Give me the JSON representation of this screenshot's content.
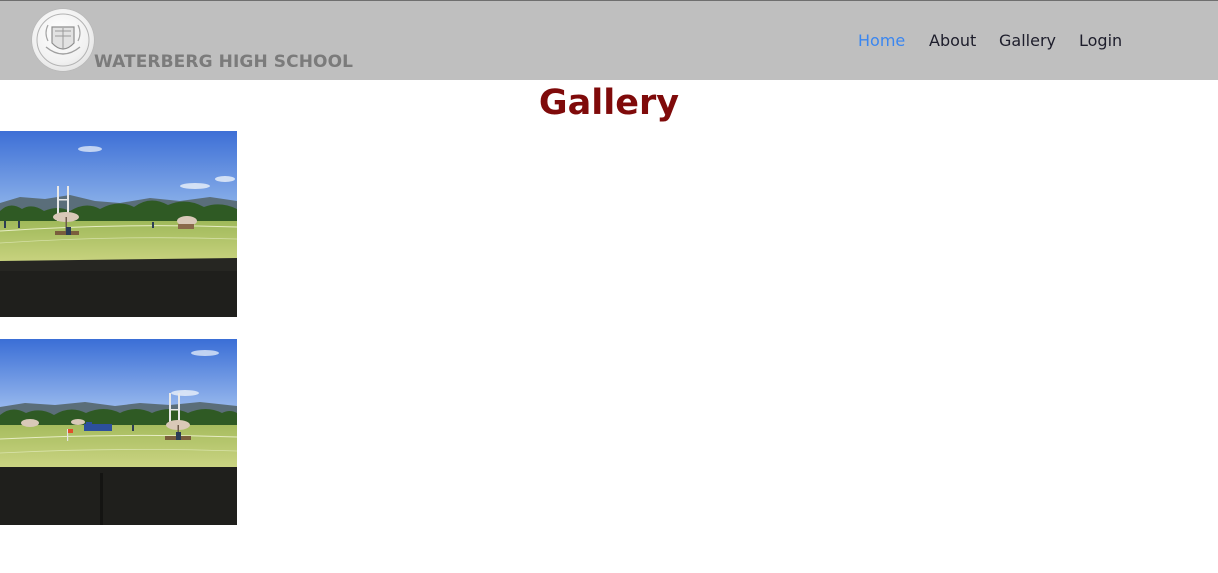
{
  "header": {
    "school_name": "WATERBERG HIGH SCHOOL",
    "logo_icon": "school-crest-icon"
  },
  "nav": {
    "items": [
      {
        "label": "Home",
        "active": true
      },
      {
        "label": "About",
        "active": false
      },
      {
        "label": "Gallery",
        "active": false
      },
      {
        "label": "Login",
        "active": false
      }
    ]
  },
  "main": {
    "title": "Gallery",
    "photos": [
      {
        "subject": "sports-field-photo",
        "scene": "school sports field with umbrellas, goal posts and mountains"
      },
      {
        "subject": "sports-field-photo",
        "scene": "school sports field with flag, umbrellas and mountains"
      }
    ]
  },
  "colors": {
    "navbar_bg": "#bfbfbf",
    "active_link": "#3a86f0",
    "title": "#7f0a0a",
    "brand_text": "#7b7b7b"
  }
}
